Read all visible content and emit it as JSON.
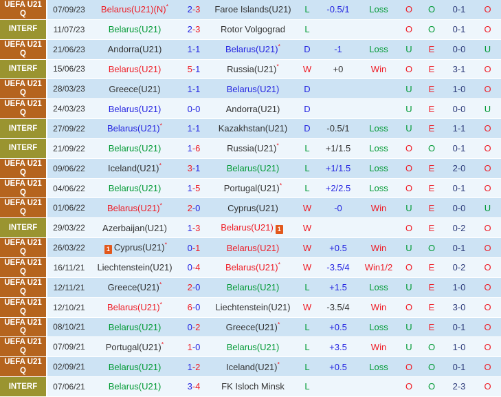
{
  "palette": {
    "red": "#ee1c25",
    "green": "#009933",
    "blue": "#2323e0",
    "black": "#333333",
    "navy": "#2c3a79",
    "row_odd_bg": "#cde3f4",
    "row_even_bg": "#eef6fc",
    "comp_uefa_bg": "#b5641e",
    "comp_interf_bg": "#9a9430"
  },
  "card_icon_label": "1",
  "rows": [
    {
      "competition": "UEFA U21 Q",
      "competition_type": "uefa",
      "date": "07/09/23",
      "home": {
        "name": "Belarus(U21)(N)",
        "color": "red",
        "asterisk": true,
        "card": null
      },
      "score": {
        "home": "2",
        "home_color": "blue",
        "away": "3",
        "away_color": "red"
      },
      "away": {
        "name": "Faroe Islands(U21)",
        "color": "black",
        "asterisk": false,
        "card": null
      },
      "result": {
        "text": "L",
        "color": "green"
      },
      "handicap": {
        "text": "-0.5/1",
        "color": "blue"
      },
      "bet": {
        "text": "Loss",
        "color": "green"
      },
      "ou": {
        "text": "O",
        "color": "red"
      },
      "oe": {
        "text": "O",
        "color": "green"
      },
      "ht": "0-1",
      "ou2": {
        "text": "O",
        "color": "red"
      }
    },
    {
      "competition": "INTERF",
      "competition_type": "interf",
      "date": "11/07/23",
      "home": {
        "name": "Belarus(U21)",
        "color": "green",
        "asterisk": false,
        "card": null
      },
      "score": {
        "home": "2",
        "home_color": "blue",
        "away": "3",
        "away_color": "red"
      },
      "away": {
        "name": "Rotor Volgograd",
        "color": "black",
        "asterisk": false,
        "card": null
      },
      "result": {
        "text": "L",
        "color": "green"
      },
      "handicap": {
        "text": "",
        "color": "blue"
      },
      "bet": {
        "text": "",
        "color": "green"
      },
      "ou": {
        "text": "O",
        "color": "red"
      },
      "oe": {
        "text": "O",
        "color": "green"
      },
      "ht": "0-1",
      "ou2": {
        "text": "O",
        "color": "red"
      }
    },
    {
      "competition": "UEFA U21 Q",
      "competition_type": "uefa",
      "date": "21/06/23",
      "home": {
        "name": "Andorra(U21)",
        "color": "black",
        "asterisk": false,
        "card": null
      },
      "score": {
        "home": "1",
        "home_color": "blue",
        "away": "1",
        "away_color": "blue"
      },
      "away": {
        "name": "Belarus(U21)",
        "color": "blue",
        "asterisk": true,
        "card": null
      },
      "result": {
        "text": "D",
        "color": "blue"
      },
      "handicap": {
        "text": "-1",
        "color": "blue"
      },
      "bet": {
        "text": "Loss",
        "color": "green"
      },
      "ou": {
        "text": "U",
        "color": "green"
      },
      "oe": {
        "text": "E",
        "color": "red"
      },
      "ht": "0-0",
      "ou2": {
        "text": "U",
        "color": "green"
      }
    },
    {
      "competition": "INTERF",
      "competition_type": "interf",
      "date": "15/06/23",
      "home": {
        "name": "Belarus(U21)",
        "color": "red",
        "asterisk": false,
        "card": null
      },
      "score": {
        "home": "5",
        "home_color": "red",
        "away": "1",
        "away_color": "blue"
      },
      "away": {
        "name": "Russia(U21)",
        "color": "black",
        "asterisk": true,
        "card": null
      },
      "result": {
        "text": "W",
        "color": "red"
      },
      "handicap": {
        "text": "+0",
        "color": "black"
      },
      "bet": {
        "text": "Win",
        "color": "red"
      },
      "ou": {
        "text": "O",
        "color": "red"
      },
      "oe": {
        "text": "E",
        "color": "red"
      },
      "ht": "3-1",
      "ou2": {
        "text": "O",
        "color": "red"
      }
    },
    {
      "competition": "UEFA U21 Q",
      "competition_type": "uefa",
      "date": "28/03/23",
      "home": {
        "name": "Greece(U21)",
        "color": "black",
        "asterisk": false,
        "card": null
      },
      "score": {
        "home": "1",
        "home_color": "blue",
        "away": "1",
        "away_color": "blue"
      },
      "away": {
        "name": "Belarus(U21)",
        "color": "blue",
        "asterisk": false,
        "card": null
      },
      "result": {
        "text": "D",
        "color": "blue"
      },
      "handicap": {
        "text": "",
        "color": "blue"
      },
      "bet": {
        "text": "",
        "color": "green"
      },
      "ou": {
        "text": "U",
        "color": "green"
      },
      "oe": {
        "text": "E",
        "color": "red"
      },
      "ht": "1-0",
      "ou2": {
        "text": "O",
        "color": "red"
      }
    },
    {
      "competition": "UEFA U21 Q",
      "competition_type": "uefa",
      "date": "24/03/23",
      "home": {
        "name": "Belarus(U21)",
        "color": "blue",
        "asterisk": false,
        "card": null
      },
      "score": {
        "home": "0",
        "home_color": "blue",
        "away": "0",
        "away_color": "blue"
      },
      "away": {
        "name": "Andorra(U21)",
        "color": "black",
        "asterisk": false,
        "card": null
      },
      "result": {
        "text": "D",
        "color": "blue"
      },
      "handicap": {
        "text": "",
        "color": "blue"
      },
      "bet": {
        "text": "",
        "color": "green"
      },
      "ou": {
        "text": "U",
        "color": "green"
      },
      "oe": {
        "text": "E",
        "color": "red"
      },
      "ht": "0-0",
      "ou2": {
        "text": "U",
        "color": "green"
      }
    },
    {
      "competition": "INTERF",
      "competition_type": "interf",
      "date": "27/09/22",
      "home": {
        "name": "Belarus(U21)",
        "color": "blue",
        "asterisk": true,
        "card": null
      },
      "score": {
        "home": "1",
        "home_color": "blue",
        "away": "1",
        "away_color": "blue"
      },
      "away": {
        "name": "Kazakhstan(U21)",
        "color": "black",
        "asterisk": false,
        "card": null
      },
      "result": {
        "text": "D",
        "color": "blue"
      },
      "handicap": {
        "text": "-0.5/1",
        "color": "black"
      },
      "bet": {
        "text": "Loss",
        "color": "green"
      },
      "ou": {
        "text": "U",
        "color": "green"
      },
      "oe": {
        "text": "E",
        "color": "red"
      },
      "ht": "1-1",
      "ou2": {
        "text": "O",
        "color": "red"
      }
    },
    {
      "competition": "INTERF",
      "competition_type": "interf",
      "date": "21/09/22",
      "home": {
        "name": "Belarus(U21)",
        "color": "green",
        "asterisk": false,
        "card": null
      },
      "score": {
        "home": "1",
        "home_color": "blue",
        "away": "6",
        "away_color": "red"
      },
      "away": {
        "name": "Russia(U21)",
        "color": "black",
        "asterisk": true,
        "card": null
      },
      "result": {
        "text": "L",
        "color": "green"
      },
      "handicap": {
        "text": "+1/1.5",
        "color": "black"
      },
      "bet": {
        "text": "Loss",
        "color": "green"
      },
      "ou": {
        "text": "O",
        "color": "red"
      },
      "oe": {
        "text": "O",
        "color": "green"
      },
      "ht": "0-1",
      "ou2": {
        "text": "O",
        "color": "red"
      }
    },
    {
      "competition": "UEFA U21 Q",
      "competition_type": "uefa",
      "date": "09/06/22",
      "home": {
        "name": "Iceland(U21)",
        "color": "black",
        "asterisk": true,
        "card": null
      },
      "score": {
        "home": "3",
        "home_color": "red",
        "away": "1",
        "away_color": "blue"
      },
      "away": {
        "name": "Belarus(U21)",
        "color": "green",
        "asterisk": false,
        "card": null
      },
      "result": {
        "text": "L",
        "color": "green"
      },
      "handicap": {
        "text": "+1/1.5",
        "color": "blue"
      },
      "bet": {
        "text": "Loss",
        "color": "green"
      },
      "ou": {
        "text": "O",
        "color": "red"
      },
      "oe": {
        "text": "E",
        "color": "red"
      },
      "ht": "2-0",
      "ou2": {
        "text": "O",
        "color": "red"
      }
    },
    {
      "competition": "UEFA U21 Q",
      "competition_type": "uefa",
      "date": "04/06/22",
      "home": {
        "name": "Belarus(U21)",
        "color": "green",
        "asterisk": false,
        "card": null
      },
      "score": {
        "home": "1",
        "home_color": "blue",
        "away": "5",
        "away_color": "red"
      },
      "away": {
        "name": "Portugal(U21)",
        "color": "black",
        "asterisk": true,
        "card": null
      },
      "result": {
        "text": "L",
        "color": "green"
      },
      "handicap": {
        "text": "+2/2.5",
        "color": "blue"
      },
      "bet": {
        "text": "Loss",
        "color": "green"
      },
      "ou": {
        "text": "O",
        "color": "red"
      },
      "oe": {
        "text": "E",
        "color": "red"
      },
      "ht": "0-1",
      "ou2": {
        "text": "O",
        "color": "red"
      }
    },
    {
      "competition": "UEFA U21 Q",
      "competition_type": "uefa",
      "date": "01/06/22",
      "home": {
        "name": "Belarus(U21)",
        "color": "red",
        "asterisk": true,
        "card": null
      },
      "score": {
        "home": "2",
        "home_color": "red",
        "away": "0",
        "away_color": "blue"
      },
      "away": {
        "name": "Cyprus(U21)",
        "color": "black",
        "asterisk": false,
        "card": null
      },
      "result": {
        "text": "W",
        "color": "red"
      },
      "handicap": {
        "text": "-0",
        "color": "blue"
      },
      "bet": {
        "text": "Win",
        "color": "red"
      },
      "ou": {
        "text": "U",
        "color": "green"
      },
      "oe": {
        "text": "E",
        "color": "red"
      },
      "ht": "0-0",
      "ou2": {
        "text": "U",
        "color": "green"
      }
    },
    {
      "competition": "INTERF",
      "competition_type": "interf",
      "date": "29/03/22",
      "home": {
        "name": "Azerbaijan(U21)",
        "color": "black",
        "asterisk": false,
        "card": null
      },
      "score": {
        "home": "1",
        "home_color": "blue",
        "away": "3",
        "away_color": "red"
      },
      "away": {
        "name": "Belarus(U21)",
        "color": "red",
        "asterisk": false,
        "card": "after"
      },
      "result": {
        "text": "W",
        "color": "red"
      },
      "handicap": {
        "text": "",
        "color": "blue"
      },
      "bet": {
        "text": "",
        "color": "red"
      },
      "ou": {
        "text": "O",
        "color": "red"
      },
      "oe": {
        "text": "E",
        "color": "red"
      },
      "ht": "0-2",
      "ou2": {
        "text": "O",
        "color": "red"
      }
    },
    {
      "competition": "UEFA U21 Q",
      "competition_type": "uefa",
      "date": "26/03/22",
      "home": {
        "name": "Cyprus(U21)",
        "color": "black",
        "asterisk": true,
        "card": "before"
      },
      "score": {
        "home": "0",
        "home_color": "blue",
        "away": "1",
        "away_color": "red"
      },
      "away": {
        "name": "Belarus(U21)",
        "color": "red",
        "asterisk": false,
        "card": null
      },
      "result": {
        "text": "W",
        "color": "red"
      },
      "handicap": {
        "text": "+0.5",
        "color": "blue"
      },
      "bet": {
        "text": "Win",
        "color": "red"
      },
      "ou": {
        "text": "U",
        "color": "green"
      },
      "oe": {
        "text": "O",
        "color": "green"
      },
      "ht": "0-1",
      "ou2": {
        "text": "O",
        "color": "red"
      }
    },
    {
      "competition": "UEFA U21 Q",
      "competition_type": "uefa",
      "date": "16/11/21",
      "home": {
        "name": "Liechtenstein(U21)",
        "color": "black",
        "asterisk": false,
        "card": null
      },
      "score": {
        "home": "0",
        "home_color": "blue",
        "away": "4",
        "away_color": "red"
      },
      "away": {
        "name": "Belarus(U21)",
        "color": "red",
        "asterisk": true,
        "card": null
      },
      "result": {
        "text": "W",
        "color": "red"
      },
      "handicap": {
        "text": "-3.5/4",
        "color": "blue"
      },
      "bet": {
        "text": "Win1/2",
        "color": "red"
      },
      "ou": {
        "text": "O",
        "color": "red"
      },
      "oe": {
        "text": "E",
        "color": "red"
      },
      "ht": "0-2",
      "ou2": {
        "text": "O",
        "color": "red"
      }
    },
    {
      "competition": "UEFA U21 Q",
      "competition_type": "uefa",
      "date": "12/11/21",
      "home": {
        "name": "Greece(U21)",
        "color": "black",
        "asterisk": true,
        "card": null
      },
      "score": {
        "home": "2",
        "home_color": "red",
        "away": "0",
        "away_color": "blue"
      },
      "away": {
        "name": "Belarus(U21)",
        "color": "green",
        "asterisk": false,
        "card": null
      },
      "result": {
        "text": "L",
        "color": "green"
      },
      "handicap": {
        "text": "+1.5",
        "color": "blue"
      },
      "bet": {
        "text": "Loss",
        "color": "green"
      },
      "ou": {
        "text": "U",
        "color": "green"
      },
      "oe": {
        "text": "E",
        "color": "red"
      },
      "ht": "1-0",
      "ou2": {
        "text": "O",
        "color": "red"
      }
    },
    {
      "competition": "UEFA U21 Q",
      "competition_type": "uefa",
      "date": "12/10/21",
      "home": {
        "name": "Belarus(U21)",
        "color": "red",
        "asterisk": true,
        "card": null
      },
      "score": {
        "home": "6",
        "home_color": "red",
        "away": "0",
        "away_color": "blue"
      },
      "away": {
        "name": "Liechtenstein(U21)",
        "color": "black",
        "asterisk": false,
        "card": null
      },
      "result": {
        "text": "W",
        "color": "red"
      },
      "handicap": {
        "text": "-3.5/4",
        "color": "black"
      },
      "bet": {
        "text": "Win",
        "color": "red"
      },
      "ou": {
        "text": "O",
        "color": "red"
      },
      "oe": {
        "text": "E",
        "color": "red"
      },
      "ht": "3-0",
      "ou2": {
        "text": "O",
        "color": "red"
      }
    },
    {
      "competition": "UEFA U21 Q",
      "competition_type": "uefa",
      "date": "08/10/21",
      "home": {
        "name": "Belarus(U21)",
        "color": "green",
        "asterisk": false,
        "card": null
      },
      "score": {
        "home": "0",
        "home_color": "blue",
        "away": "2",
        "away_color": "red"
      },
      "away": {
        "name": "Greece(U21)",
        "color": "black",
        "asterisk": true,
        "card": null
      },
      "result": {
        "text": "L",
        "color": "green"
      },
      "handicap": {
        "text": "+0.5",
        "color": "blue"
      },
      "bet": {
        "text": "Loss",
        "color": "green"
      },
      "ou": {
        "text": "U",
        "color": "green"
      },
      "oe": {
        "text": "E",
        "color": "red"
      },
      "ht": "0-1",
      "ou2": {
        "text": "O",
        "color": "red"
      }
    },
    {
      "competition": "UEFA U21 Q",
      "competition_type": "uefa",
      "date": "07/09/21",
      "home": {
        "name": "Portugal(U21)",
        "color": "black",
        "asterisk": true,
        "card": null
      },
      "score": {
        "home": "1",
        "home_color": "red",
        "away": "0",
        "away_color": "blue"
      },
      "away": {
        "name": "Belarus(U21)",
        "color": "green",
        "asterisk": false,
        "card": null
      },
      "result": {
        "text": "L",
        "color": "green"
      },
      "handicap": {
        "text": "+3.5",
        "color": "blue"
      },
      "bet": {
        "text": "Win",
        "color": "red"
      },
      "ou": {
        "text": "U",
        "color": "green"
      },
      "oe": {
        "text": "O",
        "color": "green"
      },
      "ht": "1-0",
      "ou2": {
        "text": "O",
        "color": "red"
      }
    },
    {
      "competition": "UEFA U21 Q",
      "competition_type": "uefa",
      "date": "02/09/21",
      "home": {
        "name": "Belarus(U21)",
        "color": "green",
        "asterisk": false,
        "card": null
      },
      "score": {
        "home": "1",
        "home_color": "blue",
        "away": "2",
        "away_color": "red"
      },
      "away": {
        "name": "Iceland(U21)",
        "color": "black",
        "asterisk": true,
        "card": null
      },
      "result": {
        "text": "L",
        "color": "green"
      },
      "handicap": {
        "text": "+0.5",
        "color": "blue"
      },
      "bet": {
        "text": "Loss",
        "color": "green"
      },
      "ou": {
        "text": "O",
        "color": "red"
      },
      "oe": {
        "text": "O",
        "color": "green"
      },
      "ht": "0-1",
      "ou2": {
        "text": "O",
        "color": "red"
      }
    },
    {
      "competition": "INTERF",
      "competition_type": "interf",
      "date": "07/06/21",
      "home": {
        "name": "Belarus(U21)",
        "color": "green",
        "asterisk": false,
        "card": null
      },
      "score": {
        "home": "3",
        "home_color": "blue",
        "away": "4",
        "away_color": "red"
      },
      "away": {
        "name": "FK Isloch Minsk",
        "color": "black",
        "asterisk": false,
        "card": null
      },
      "result": {
        "text": "L",
        "color": "green"
      },
      "handicap": {
        "text": "",
        "color": "blue"
      },
      "bet": {
        "text": "",
        "color": "green"
      },
      "ou": {
        "text": "O",
        "color": "red"
      },
      "oe": {
        "text": "O",
        "color": "green"
      },
      "ht": "2-3",
      "ou2": {
        "text": "O",
        "color": "red"
      }
    }
  ]
}
